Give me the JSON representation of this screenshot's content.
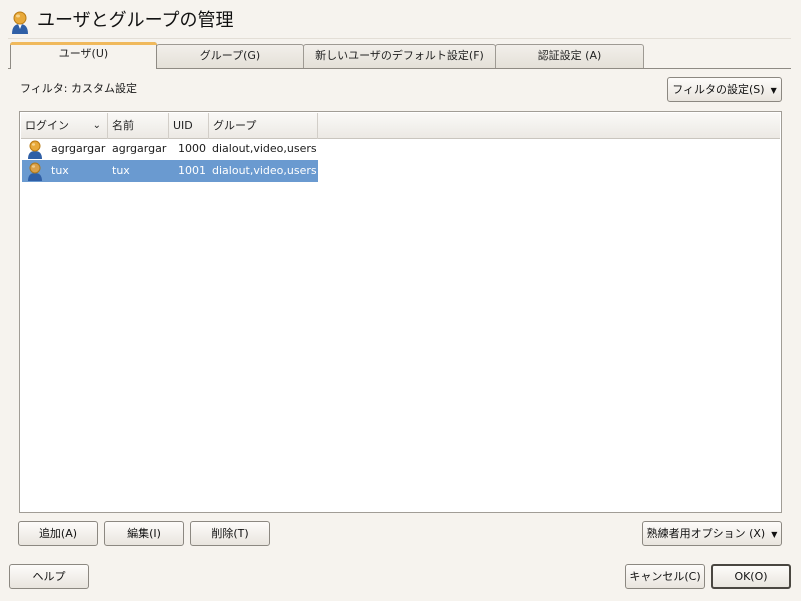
{
  "window": {
    "title": "ユーザとグループの管理",
    "icon": "user-group-icon"
  },
  "tabs": [
    {
      "label": "ユーザ(U)",
      "active": true
    },
    {
      "label": "グループ(G)",
      "active": false
    },
    {
      "label": "新しいユーザのデフォルト設定(F)",
      "active": false
    },
    {
      "label": "認証設定 (A)",
      "active": false
    }
  ],
  "filter": {
    "label": "フィルタ: カスタム設定",
    "button_label": "フィルタの設定(S)"
  },
  "table": {
    "columns": [
      "ログイン",
      "名前",
      "UID",
      "グループ"
    ],
    "sort_column": "ログイン",
    "rows": [
      {
        "login": "agrgargar",
        "name": "agrgargar",
        "uid": "1000",
        "groups": "dialout,video,users",
        "selected": false
      },
      {
        "login": "tux",
        "name": "tux",
        "uid": "1001",
        "groups": "dialout,video,users",
        "selected": true
      }
    ]
  },
  "actions": {
    "add": "追加(A)",
    "edit": "編集(I)",
    "delete": "削除(T)",
    "expert": "熟練者用オプション (X)"
  },
  "footer": {
    "help": "ヘルプ",
    "cancel": "キャンセル(C)",
    "ok": "OK(O)"
  },
  "colors": {
    "selection": "#6a9ad0",
    "active_tab_accent": "#f0b95c",
    "background": "#f6f3ee"
  }
}
